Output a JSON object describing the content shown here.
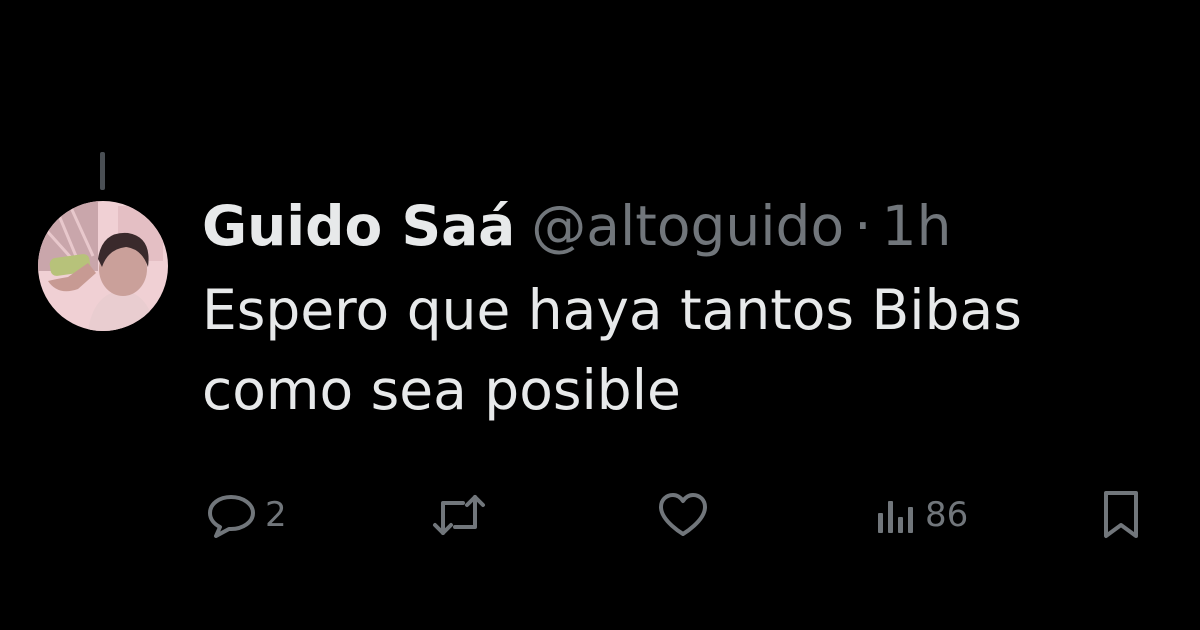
{
  "tweet": {
    "author": {
      "display_name": "Guido Saá",
      "handle": "@altoguido"
    },
    "separator": "·",
    "time": "1h",
    "text_line1": "Espero que haya tantos Bibas",
    "text_line2": "como sea posible"
  },
  "actions": {
    "reply_count": "2",
    "views_count": "86"
  },
  "icons": {
    "reply": "speech-bubble-icon",
    "retweet": "retweet-arrows-icon",
    "like": "heart-icon",
    "views": "bar-chart-icon",
    "bookmark": "bookmark-icon"
  },
  "colors": {
    "background": "#000000",
    "primary_text": "#e7e9ea",
    "secondary_text": "#71767b"
  }
}
